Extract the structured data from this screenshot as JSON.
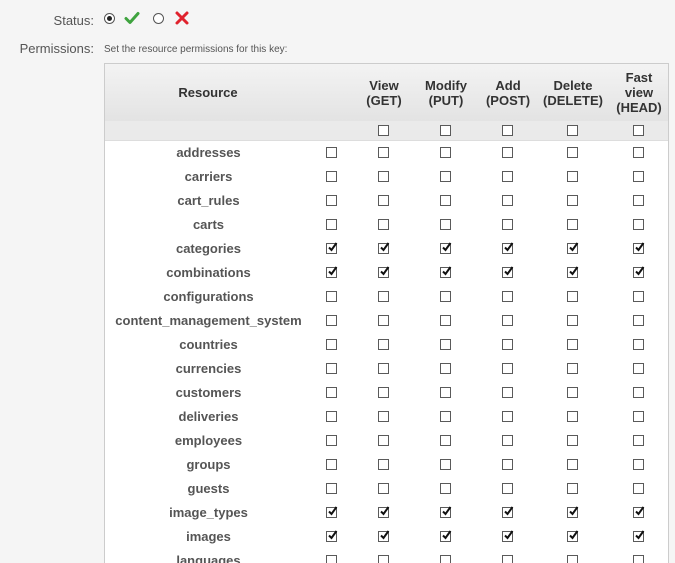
{
  "status": {
    "label": "Status:",
    "enabled_option": "enabled",
    "disabled_option": "disabled",
    "selected": "enabled",
    "enabled_icon": "check-icon",
    "disabled_icon": "cross-icon",
    "colors": {
      "check": "#3fa33f",
      "cross": "#e0222d"
    }
  },
  "permissions": {
    "label": "Permissions:",
    "description": "Set the resource permissions for this key:",
    "columns": [
      {
        "key": "resource",
        "label": "Resource"
      },
      {
        "key": "all",
        "label": ""
      },
      {
        "key": "view",
        "label": "View\n(GET)"
      },
      {
        "key": "modify",
        "label": "Modify\n(PUT)"
      },
      {
        "key": "add",
        "label": "Add\n(POST)"
      },
      {
        "key": "delete",
        "label": "Delete\n(DELETE)"
      },
      {
        "key": "fast_view",
        "label": "Fast\nview\n(HEAD)"
      }
    ],
    "select_all_row": [
      false,
      false,
      false,
      false,
      false
    ],
    "rows": [
      {
        "name": "addresses",
        "checks": [
          false,
          false,
          false,
          false,
          false,
          false
        ]
      },
      {
        "name": "carriers",
        "checks": [
          false,
          false,
          false,
          false,
          false,
          false
        ]
      },
      {
        "name": "cart_rules",
        "checks": [
          false,
          false,
          false,
          false,
          false,
          false
        ]
      },
      {
        "name": "carts",
        "checks": [
          false,
          false,
          false,
          false,
          false,
          false
        ]
      },
      {
        "name": "categories",
        "checks": [
          true,
          true,
          true,
          true,
          true,
          true
        ]
      },
      {
        "name": "combinations",
        "checks": [
          true,
          true,
          true,
          true,
          true,
          true
        ]
      },
      {
        "name": "configurations",
        "checks": [
          false,
          false,
          false,
          false,
          false,
          false
        ]
      },
      {
        "name": "content_management_system",
        "checks": [
          false,
          false,
          false,
          false,
          false,
          false
        ]
      },
      {
        "name": "countries",
        "checks": [
          false,
          false,
          false,
          false,
          false,
          false
        ]
      },
      {
        "name": "currencies",
        "checks": [
          false,
          false,
          false,
          false,
          false,
          false
        ]
      },
      {
        "name": "customers",
        "checks": [
          false,
          false,
          false,
          false,
          false,
          false
        ]
      },
      {
        "name": "deliveries",
        "checks": [
          false,
          false,
          false,
          false,
          false,
          false
        ]
      },
      {
        "name": "employees",
        "checks": [
          false,
          false,
          false,
          false,
          false,
          false
        ]
      },
      {
        "name": "groups",
        "checks": [
          false,
          false,
          false,
          false,
          false,
          false
        ]
      },
      {
        "name": "guests",
        "checks": [
          false,
          false,
          false,
          false,
          false,
          false
        ]
      },
      {
        "name": "image_types",
        "checks": [
          true,
          true,
          true,
          true,
          true,
          true
        ]
      },
      {
        "name": "images",
        "checks": [
          true,
          true,
          true,
          true,
          true,
          true
        ]
      },
      {
        "name": "languages",
        "checks": [
          false,
          false,
          false,
          false,
          false,
          false
        ]
      }
    ]
  }
}
